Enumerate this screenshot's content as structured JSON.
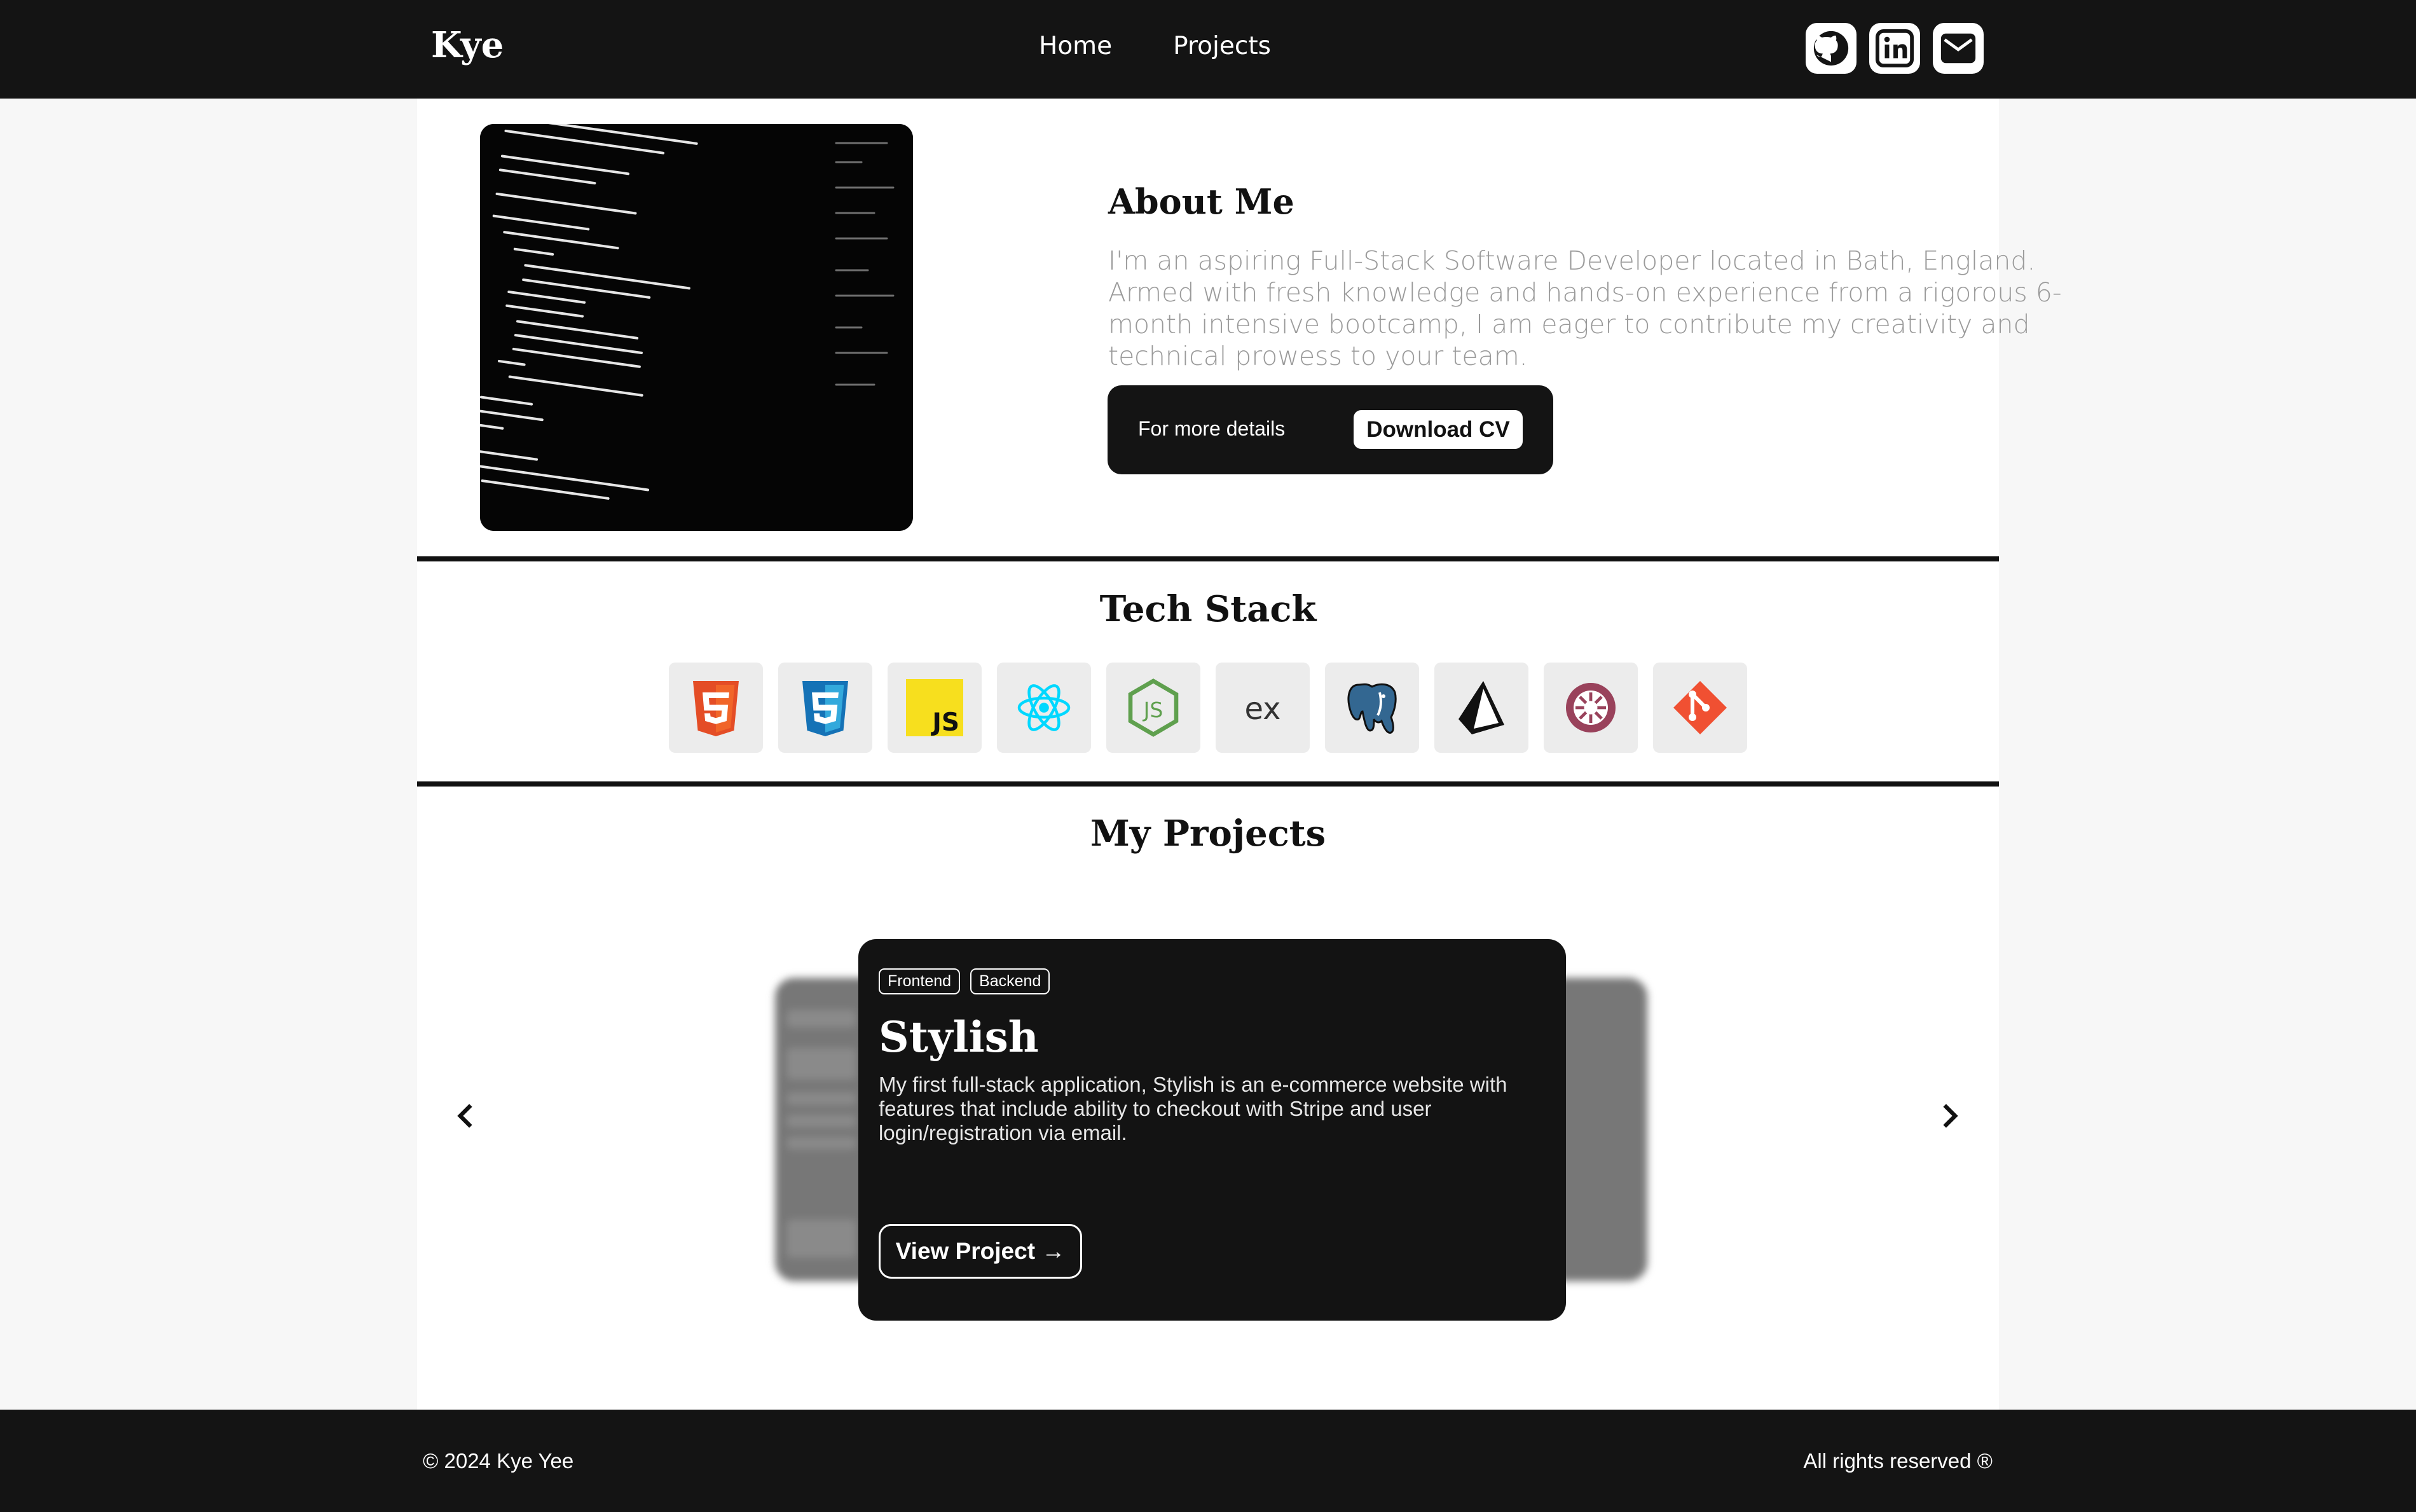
{
  "header": {
    "brand": "Kye",
    "nav": [
      "Home",
      "Projects"
    ],
    "socials": [
      "github-icon",
      "linkedin-icon",
      "mail-icon"
    ]
  },
  "about": {
    "title": "About Me",
    "description": "I'm an aspiring Full-Stack Software Developer located in Bath, England. Armed with fresh knowledge and hands-on experience from a rigorous 6-month intensive bootcamp, I am eager to contribute my creativity and technical prowess to your team.",
    "cta_label": "For more details",
    "cta_button": "Download CV",
    "image_icon": "code-screenshot-image"
  },
  "tech_stack": {
    "title": "Tech Stack",
    "icons": [
      "html5-icon",
      "css3-icon",
      "javascript-icon",
      "react-icon",
      "nodejs-icon",
      "express-icon",
      "postgresql-icon",
      "prisma-icon",
      "jest-icon",
      "git-icon"
    ]
  },
  "projects": {
    "title": "My Projects",
    "card": {
      "tags": [
        "Frontend",
        "Backend"
      ],
      "title": "Stylish",
      "description": "My first full-stack application, Stylish is an e-commerce website with features that include ability to checkout with Stripe and user login/registration via email.",
      "button": "View Project →"
    }
  },
  "footer": {
    "copyright": "© 2024 Kye Yee",
    "rights": "All rights reserved ®"
  },
  "colors": {
    "dark": "#141414",
    "panel": "#ffffff",
    "page_bg": "#f7f7f7",
    "muted_text": "#9a9a9a"
  }
}
